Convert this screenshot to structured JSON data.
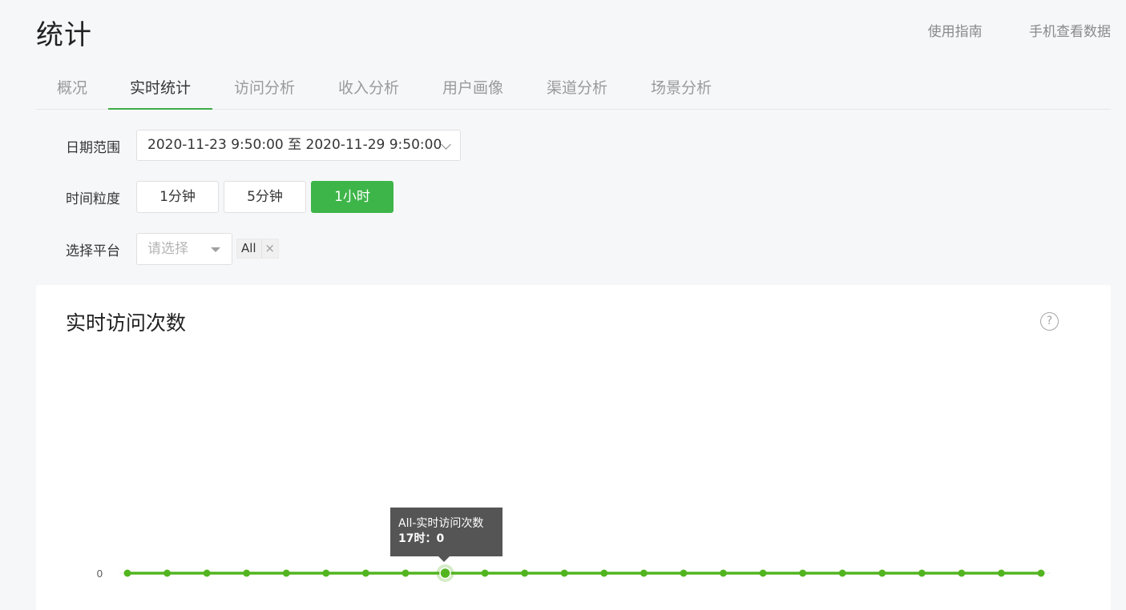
{
  "header": {
    "title": "统计",
    "links": [
      "使用指南",
      "手机查看数据"
    ]
  },
  "tabs": [
    "概况",
    "实时统计",
    "访问分析",
    "收入分析",
    "用户画像",
    "渠道分析",
    "场景分析"
  ],
  "active_tab": "实时统计",
  "filters": {
    "date_label": "日期范围",
    "date_value": "2020-11-23 9:50:00 至 2020-11-29 9:50:00",
    "granularity_label": "时间粒度",
    "granularity_options": [
      "1分钟",
      "5分钟",
      "1小时"
    ],
    "granularity_selected": "1小时",
    "platform_label": "选择平台",
    "platform_placeholder": "请选择",
    "platform_tag": "All",
    "tag_close": "×"
  },
  "card": {
    "title": "实时访问次数",
    "help": "?"
  },
  "tooltip": {
    "title": "All-实时访问次数",
    "value": "17时：0"
  },
  "chart_data": {
    "type": "line",
    "series": [
      {
        "name": "All-实时访问次数",
        "values": [
          0,
          0,
          0,
          0,
          0,
          0,
          0,
          0,
          0,
          0,
          0,
          0,
          0,
          0,
          0,
          0,
          0,
          0,
          0,
          0,
          0,
          0,
          0,
          0
        ]
      }
    ],
    "y_tick_labels": [
      "0"
    ],
    "highlighted_index": 8,
    "color": "#52b520"
  },
  "colors": {
    "accent": "#3eb549",
    "line": "#52b520"
  }
}
